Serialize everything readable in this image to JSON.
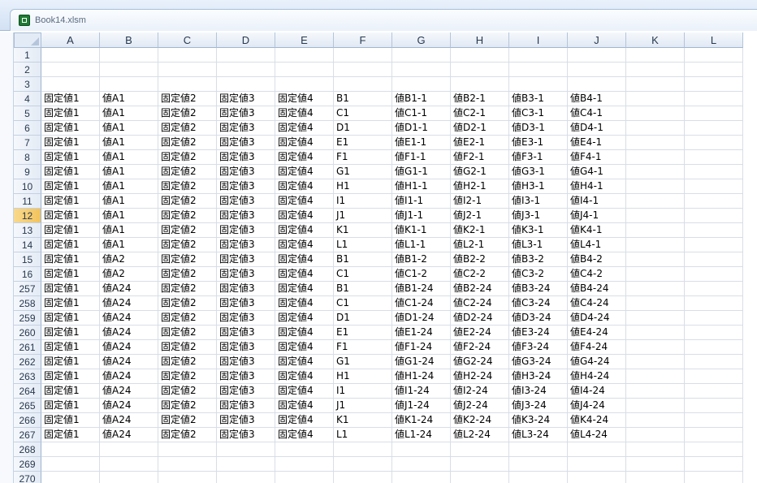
{
  "window": {
    "title": "Book14.xlsm"
  },
  "sheet": {
    "columns": [
      "A",
      "B",
      "C",
      "D",
      "E",
      "F",
      "G",
      "H",
      "I",
      "J",
      "K",
      "L"
    ],
    "active_row": "12",
    "rows": [
      {
        "num": "1",
        "cells": [
          "",
          "",
          "",
          "",
          "",
          "",
          "",
          "",
          "",
          ""
        ]
      },
      {
        "num": "2",
        "cells": [
          "",
          "",
          "",
          "",
          "",
          "",
          "",
          "",
          "",
          ""
        ]
      },
      {
        "num": "3",
        "cells": [
          "",
          "",
          "",
          "",
          "",
          "",
          "",
          "",
          "",
          ""
        ]
      },
      {
        "num": "4",
        "cells": [
          "固定値1",
          "値A1",
          "固定値2",
          "固定値3",
          "固定値4",
          "B1",
          "値B1-1",
          "値B2-1",
          "値B3-1",
          "値B4-1"
        ]
      },
      {
        "num": "5",
        "cells": [
          "固定値1",
          "値A1",
          "固定値2",
          "固定値3",
          "固定値4",
          "C1",
          "値C1-1",
          "値C2-1",
          "値C3-1",
          "値C4-1"
        ]
      },
      {
        "num": "6",
        "cells": [
          "固定値1",
          "値A1",
          "固定値2",
          "固定値3",
          "固定値4",
          "D1",
          "値D1-1",
          "値D2-1",
          "値D3-1",
          "値D4-1"
        ]
      },
      {
        "num": "7",
        "cells": [
          "固定値1",
          "値A1",
          "固定値2",
          "固定値3",
          "固定値4",
          "E1",
          "値E1-1",
          "値E2-1",
          "値E3-1",
          "値E4-1"
        ]
      },
      {
        "num": "8",
        "cells": [
          "固定値1",
          "値A1",
          "固定値2",
          "固定値3",
          "固定値4",
          "F1",
          "値F1-1",
          "値F2-1",
          "値F3-1",
          "値F4-1"
        ]
      },
      {
        "num": "9",
        "cells": [
          "固定値1",
          "値A1",
          "固定値2",
          "固定値3",
          "固定値4",
          "G1",
          "値G1-1",
          "値G2-1",
          "値G3-1",
          "値G4-1"
        ]
      },
      {
        "num": "10",
        "cells": [
          "固定値1",
          "値A1",
          "固定値2",
          "固定値3",
          "固定値4",
          "H1",
          "値H1-1",
          "値H2-1",
          "値H3-1",
          "値H4-1"
        ]
      },
      {
        "num": "11",
        "cells": [
          "固定値1",
          "値A1",
          "固定値2",
          "固定値3",
          "固定値4",
          "I1",
          "値I1-1",
          "値I2-1",
          "値I3-1",
          "値I4-1"
        ]
      },
      {
        "num": "12",
        "cells": [
          "固定値1",
          "値A1",
          "固定値2",
          "固定値3",
          "固定値4",
          "J1",
          "値J1-1",
          "値J2-1",
          "値J3-1",
          "値J4-1"
        ]
      },
      {
        "num": "13",
        "cells": [
          "固定値1",
          "値A1",
          "固定値2",
          "固定値3",
          "固定値4",
          "K1",
          "値K1-1",
          "値K2-1",
          "値K3-1",
          "値K4-1"
        ]
      },
      {
        "num": "14",
        "cells": [
          "固定値1",
          "値A1",
          "固定値2",
          "固定値3",
          "固定値4",
          "L1",
          "値L1-1",
          "値L2-1",
          "値L3-1",
          "値L4-1"
        ]
      },
      {
        "num": "15",
        "cells": [
          "固定値1",
          "値A2",
          "固定値2",
          "固定値3",
          "固定値4",
          "B1",
          "値B1-2",
          "値B2-2",
          "値B3-2",
          "値B4-2"
        ]
      },
      {
        "num": "16",
        "cells": [
          "固定値1",
          "値A2",
          "固定値2",
          "固定値3",
          "固定値4",
          "C1",
          "値C1-2",
          "値C2-2",
          "値C3-2",
          "値C4-2"
        ]
      },
      {
        "num": "257",
        "cells": [
          "固定値1",
          "値A24",
          "固定値2",
          "固定値3",
          "固定値4",
          "B1",
          "値B1-24",
          "値B2-24",
          "値B3-24",
          "値B4-24"
        ]
      },
      {
        "num": "258",
        "cells": [
          "固定値1",
          "値A24",
          "固定値2",
          "固定値3",
          "固定値4",
          "C1",
          "値C1-24",
          "値C2-24",
          "値C3-24",
          "値C4-24"
        ]
      },
      {
        "num": "259",
        "cells": [
          "固定値1",
          "値A24",
          "固定値2",
          "固定値3",
          "固定値4",
          "D1",
          "値D1-24",
          "値D2-24",
          "値D3-24",
          "値D4-24"
        ]
      },
      {
        "num": "260",
        "cells": [
          "固定値1",
          "値A24",
          "固定値2",
          "固定値3",
          "固定値4",
          "E1",
          "値E1-24",
          "値E2-24",
          "値E3-24",
          "値E4-24"
        ]
      },
      {
        "num": "261",
        "cells": [
          "固定値1",
          "値A24",
          "固定値2",
          "固定値3",
          "固定値4",
          "F1",
          "値F1-24",
          "値F2-24",
          "値F3-24",
          "値F4-24"
        ]
      },
      {
        "num": "262",
        "cells": [
          "固定値1",
          "値A24",
          "固定値2",
          "固定値3",
          "固定値4",
          "G1",
          "値G1-24",
          "値G2-24",
          "値G3-24",
          "値G4-24"
        ]
      },
      {
        "num": "263",
        "cells": [
          "固定値1",
          "値A24",
          "固定値2",
          "固定値3",
          "固定値4",
          "H1",
          "値H1-24",
          "値H2-24",
          "値H3-24",
          "値H4-24"
        ]
      },
      {
        "num": "264",
        "cells": [
          "固定値1",
          "値A24",
          "固定値2",
          "固定値3",
          "固定値4",
          "I1",
          "値I1-24",
          "値I2-24",
          "値I3-24",
          "値I4-24"
        ]
      },
      {
        "num": "265",
        "cells": [
          "固定値1",
          "値A24",
          "固定値2",
          "固定値3",
          "固定値4",
          "J1",
          "値J1-24",
          "値J2-24",
          "値J3-24",
          "値J4-24"
        ]
      },
      {
        "num": "266",
        "cells": [
          "固定値1",
          "値A24",
          "固定値2",
          "固定値3",
          "固定値4",
          "K1",
          "値K1-24",
          "値K2-24",
          "値K3-24",
          "値K4-24"
        ]
      },
      {
        "num": "267",
        "cells": [
          "固定値1",
          "値A24",
          "固定値2",
          "固定値3",
          "固定値4",
          "L1",
          "値L1-24",
          "値L2-24",
          "値L3-24",
          "値L4-24"
        ]
      },
      {
        "num": "268",
        "cells": [
          "",
          "",
          "",
          "",
          "",
          "",
          "",
          "",
          "",
          ""
        ]
      },
      {
        "num": "269",
        "cells": [
          "",
          "",
          "",
          "",
          "",
          "",
          "",
          "",
          "",
          ""
        ]
      },
      {
        "num": "270",
        "cells": [
          "",
          "",
          "",
          "",
          "",
          "",
          "",
          "",
          "",
          ""
        ]
      }
    ]
  }
}
